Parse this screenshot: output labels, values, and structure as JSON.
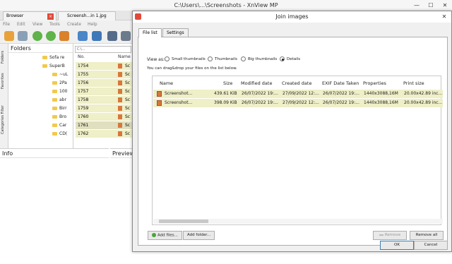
{
  "window": {
    "title": "C:\\Users\\...\\Screenshots - XnView MP",
    "tabs": [
      {
        "label": "Browser"
      },
      {
        "label": "Screensh...in 1.jpg"
      }
    ],
    "menu": [
      "File",
      "Edit",
      "View",
      "Tools",
      "Create",
      "Help"
    ]
  },
  "side_tabs": [
    "Folders",
    "Favorites",
    "Categories Filter"
  ],
  "folders": {
    "title": "Folders",
    "items": [
      {
        "label": "Sofa re"
      },
      {
        "label": "SuperB"
      },
      {
        "label": "~uL"
      },
      {
        "label": "2Pa"
      },
      {
        "label": "100"
      },
      {
        "label": "abr"
      },
      {
        "label": "Birr"
      },
      {
        "label": "Bro"
      },
      {
        "label": "Car"
      },
      {
        "label": "CD("
      }
    ]
  },
  "file_list": {
    "address": "C:\\...",
    "col_no": "No.",
    "col_name": "Name",
    "rows": [
      {
        "num": "1754",
        "name": "Sc"
      },
      {
        "num": "1755",
        "name": "Sc"
      },
      {
        "num": "1756",
        "name": "Sc"
      },
      {
        "num": "1757",
        "name": "Sc"
      },
      {
        "num": "1758",
        "name": "Sc"
      },
      {
        "num": "1759",
        "name": "Sc"
      },
      {
        "num": "1760",
        "name": "Sc"
      },
      {
        "num": "1761",
        "name": "Sc"
      },
      {
        "num": "1762",
        "name": "Sc"
      }
    ]
  },
  "info_panel": {
    "title": "Info"
  },
  "preview_panel": {
    "title": "Preview"
  },
  "dialog": {
    "title": "Join images",
    "tabs": [
      {
        "label": "File list"
      },
      {
        "label": "Settings"
      }
    ],
    "view_as_label": "View as:",
    "view_options": [
      {
        "label": "Small thumbnails",
        "selected": false
      },
      {
        "label": "Thumbnails",
        "selected": false
      },
      {
        "label": "Big thumbnails",
        "selected": false
      },
      {
        "label": "Details",
        "selected": true
      }
    ],
    "hint": "You can drag&drop your files on the list below.",
    "columns": [
      "Name",
      "Size",
      "Modified date",
      "Created date",
      "EXIF Date Taken",
      "Properties",
      "Print size"
    ],
    "rows": [
      {
        "name": "Screenshot...",
        "size": "439.61 KiB",
        "modified": "26/07/2022 19:...",
        "created": "27/09/2022 12:...",
        "exif": "26/07/2022 19:...",
        "properties": "1440x3088,16M",
        "print": "20.00x42.89 inc..."
      },
      {
        "name": "Screenshot...",
        "size": "398.09 KiB",
        "modified": "26/07/2022 19:...",
        "created": "27/09/2022 12:...",
        "exif": "26/07/2022 19:...",
        "properties": "1440x3088,16M",
        "print": "20.00x42.89 inc..."
      }
    ],
    "buttons": {
      "add_files": "Add files...",
      "add_folder": "Add folder...",
      "remove": "Remove",
      "remove_all": "Remove all",
      "ok": "OK",
      "cancel": "Cancel"
    }
  },
  "colors": {
    "row_highlight": "#efefc8",
    "folder_yellow": "#f3c94c",
    "close_red": "#e04a3a"
  }
}
